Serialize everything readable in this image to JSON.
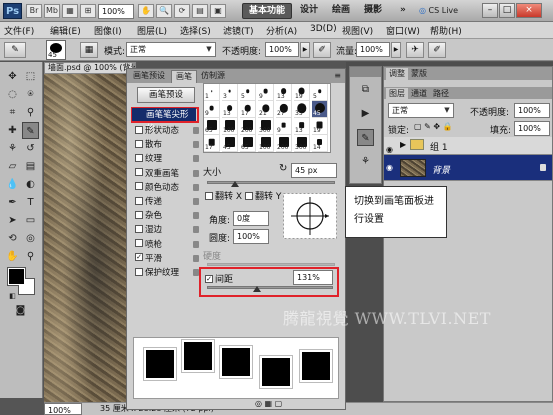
{
  "titlebar": {
    "logo": "Ps",
    "zoom_value": "100%",
    "workspaces": [
      "基本功能",
      "设计",
      "绘画",
      "摄影"
    ],
    "more": "»",
    "cslive": "CS Live",
    "min": "–",
    "max": "□",
    "close": "×"
  },
  "menubar": {
    "items": [
      "文件(F)",
      "编辑(E)",
      "图像(I)",
      "图层(L)",
      "选择(S)",
      "滤镜(T)",
      "分析(A)",
      "3D(D)",
      "视图(V)",
      "窗口(W)",
      "帮助(H)"
    ]
  },
  "optbar": {
    "brush_size": "45",
    "mode_label": "模式:",
    "mode_value": "正常",
    "opacity_label": "不透明度:",
    "opacity_value": "100%",
    "flow_label": "流量:",
    "flow_value": "100%"
  },
  "document": {
    "tab_title": "墙面.psd @ 100% (背景, RGB/8)",
    "status_zoom": "100%",
    "status_info": "35 厘米 x 28.28 厘米 (72 ppi)"
  },
  "brush_panel": {
    "tabs": [
      "画笔预设",
      "画笔",
      "仿制源"
    ],
    "active_tab": "画笔",
    "presets_button": "画笔预设",
    "selected_option": "画笔笔尖形状",
    "options": [
      {
        "label": "形状动态",
        "checked": false
      },
      {
        "label": "散布",
        "checked": false
      },
      {
        "label": "纹理",
        "checked": false
      },
      {
        "label": "双重画笔",
        "checked": false
      },
      {
        "label": "颜色动态",
        "checked": false
      },
      {
        "label": "传递",
        "checked": false
      },
      {
        "label": "杂色",
        "checked": false
      },
      {
        "label": "湿边",
        "checked": false
      },
      {
        "label": "喷枪",
        "checked": false
      },
      {
        "label": "平滑",
        "checked": true
      },
      {
        "label": "保护纹理",
        "checked": false
      }
    ],
    "tip_grid": [
      {
        "size": "1"
      },
      {
        "size": "3"
      },
      {
        "size": "5"
      },
      {
        "size": "9"
      },
      {
        "size": "13"
      },
      {
        "size": "19"
      },
      {
        "size": "5"
      },
      {
        "size": "9"
      },
      {
        "size": "13"
      },
      {
        "size": "17"
      },
      {
        "size": "21"
      },
      {
        "size": "27"
      },
      {
        "size": "35"
      },
      {
        "size": "45"
      },
      {
        "size": "65"
      },
      {
        "size": "100"
      },
      {
        "size": "200"
      },
      {
        "size": "300"
      },
      {
        "size": "9"
      },
      {
        "size": "13"
      },
      {
        "size": "19"
      },
      {
        "size": "17"
      },
      {
        "size": "45"
      },
      {
        "size": "65"
      },
      {
        "size": "100"
      },
      {
        "size": "200"
      },
      {
        "size": "300"
      },
      {
        "size": "14"
      }
    ],
    "size_label": "大小",
    "size_value": "45 px",
    "flip_x": "翻转 X",
    "flip_y": "翻转 Y",
    "angle_label": "角度:",
    "angle_value": "0度",
    "roundness_label": "圆度:",
    "roundness_value": "100%",
    "hardness_label": "硬度",
    "spacing_label": "间距",
    "spacing_checked": true,
    "spacing_value": "131%",
    "spacing_level": 0.4
  },
  "layers_panel": {
    "tabs": [
      "图层",
      "通道",
      "路径"
    ],
    "top_tabs": [
      "调整",
      "蒙版"
    ],
    "blend_mode": "正常",
    "opacity_label": "不透明度:",
    "opacity_value": "100%",
    "lock_label": "锁定:",
    "fill_label": "填充:",
    "fill_value": "100%",
    "layers": [
      {
        "name": "组 1",
        "type": "group",
        "selected": false
      },
      {
        "name": "背景",
        "type": "image",
        "selected": true
      }
    ]
  },
  "callout": {
    "text": "切换到画笔面板进行设置"
  },
  "watermark": "腾龍視覺 WWW.TLVI.NET",
  "colors": {
    "selection_blue": "#142c6b",
    "highlight_red": "#e0222a",
    "layer_selected": "#1a2f7c"
  }
}
